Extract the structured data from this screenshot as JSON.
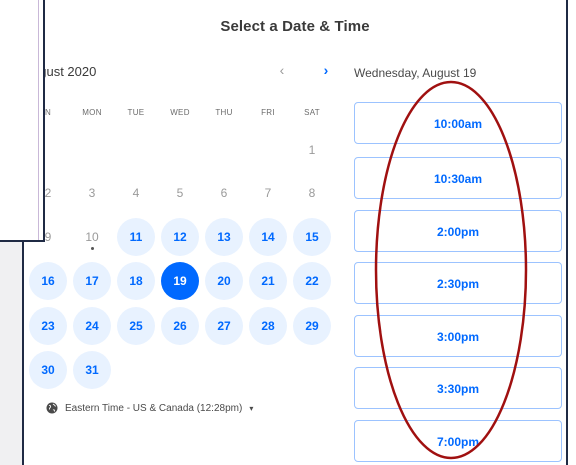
{
  "title": "Select a Date & Time",
  "calendar": {
    "month_label": "ugust 2020",
    "prev_label": "‹",
    "next_label": "›",
    "weekdays": [
      "N",
      "MON",
      "TUE",
      "WED",
      "THU",
      "FRI",
      "SAT"
    ],
    "selected_day": "19"
  },
  "timezone": {
    "icon": "globe-icon",
    "label": "Eastern Time - US & Canada (12:28pm)",
    "caret": "▾"
  },
  "schedule": {
    "date_heading": "Wednesday, August 19",
    "slots": [
      "10:00am",
      "10:30am",
      "2:00pm",
      "2:30pm",
      "3:00pm",
      "3:30pm",
      "7:00pm"
    ]
  },
  "colors": {
    "accent": "#0069ff",
    "available_bg": "#e8f2ff",
    "annotation": "#a01010"
  }
}
